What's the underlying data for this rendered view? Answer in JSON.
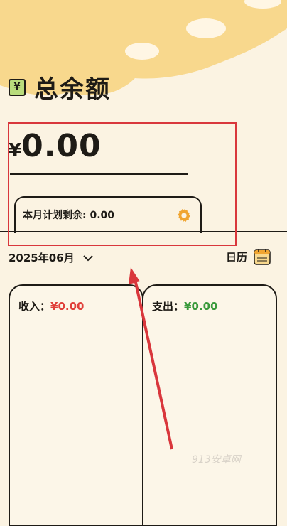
{
  "header": {
    "title": "总余额",
    "wallet_icon_glyph": "¥"
  },
  "balance": {
    "currency": "¥",
    "amount": "0.00"
  },
  "plan": {
    "label": "本月计划剩余: ",
    "value": "0.00"
  },
  "month_selector": {
    "label": "2025年06月"
  },
  "calendar": {
    "label": "日历"
  },
  "income": {
    "label": "收入：",
    "value": "¥0.00"
  },
  "expense": {
    "label": "支出：",
    "value": "¥0.00"
  },
  "watermark": "913安卓网",
  "colors": {
    "background": "#fbf3e2",
    "banner": "#f8d88d",
    "income": "#e0403a",
    "expense": "#3a9a3c",
    "highlight_frame": "#d9373c",
    "gear": "#f0a531"
  }
}
